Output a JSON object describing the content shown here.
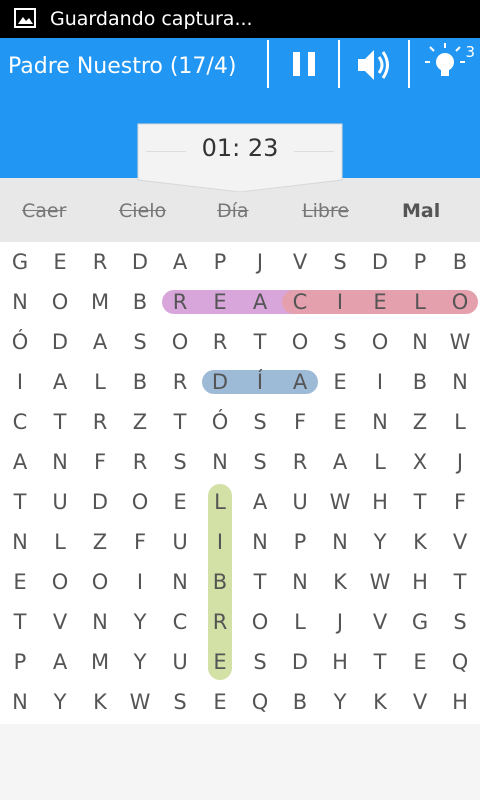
{
  "status_bar": {
    "icon": "image-icon",
    "text": "Guardando captura..."
  },
  "header": {
    "title": "Padre Nuestro (17/4)",
    "pause_icon": "pause-icon",
    "sound_icon": "volume-icon",
    "hint_icon": "lightbulb-icon",
    "hint_count": "3",
    "accent_color": "#2196f3"
  },
  "timer": {
    "value": "01: 23"
  },
  "words": [
    {
      "text": "Caer",
      "found": true
    },
    {
      "text": "Cielo",
      "found": true
    },
    {
      "text": "Día",
      "found": true
    },
    {
      "text": "Libre",
      "found": true
    },
    {
      "text": "Mal",
      "found": false
    }
  ],
  "grid": [
    [
      "G",
      "E",
      "R",
      "D",
      "A",
      "P",
      "J",
      "V",
      "S",
      "D",
      "P",
      "B"
    ],
    [
      "N",
      "O",
      "M",
      "B",
      "R",
      "E",
      "A",
      "C",
      "I",
      "E",
      "L",
      "O"
    ],
    [
      "Ó",
      "D",
      "A",
      "S",
      "O",
      "R",
      "T",
      "O",
      "S",
      "O",
      "N",
      "W"
    ],
    [
      "I",
      "A",
      "L",
      "B",
      "R",
      "D",
      "Í",
      "A",
      "E",
      "I",
      "B",
      "N"
    ],
    [
      "C",
      "T",
      "R",
      "Z",
      "T",
      "Ó",
      "S",
      "F",
      "E",
      "N",
      "Z",
      "L"
    ],
    [
      "A",
      "N",
      "F",
      "R",
      "S",
      "N",
      "S",
      "R",
      "A",
      "L",
      "X",
      "J"
    ],
    [
      "T",
      "U",
      "D",
      "O",
      "E",
      "L",
      "A",
      "U",
      "W",
      "H",
      "T",
      "F"
    ],
    [
      "N",
      "L",
      "Z",
      "F",
      "U",
      "I",
      "N",
      "P",
      "N",
      "Y",
      "K",
      "V"
    ],
    [
      "E",
      "O",
      "O",
      "I",
      "N",
      "B",
      "T",
      "N",
      "K",
      "W",
      "H",
      "T"
    ],
    [
      "T",
      "V",
      "N",
      "Y",
      "C",
      "R",
      "O",
      "L",
      "J",
      "V",
      "G",
      "S"
    ],
    [
      "P",
      "A",
      "M",
      "Y",
      "U",
      "E",
      "S",
      "D",
      "H",
      "T",
      "E",
      "Q"
    ],
    [
      "N",
      "Y",
      "K",
      "W",
      "S",
      "E",
      "Q",
      "B",
      "Y",
      "K",
      "V",
      "H"
    ]
  ],
  "highlights": [
    {
      "word": "Caer",
      "color": "#d9a6dc",
      "from": [
        1,
        4
      ],
      "to": [
        1,
        7
      ]
    },
    {
      "word": "Cielo",
      "color": "#e5a0ad",
      "from": [
        1,
        7
      ],
      "to": [
        1,
        11
      ]
    },
    {
      "word": "Día",
      "color": "#9dbad6",
      "from": [
        3,
        5
      ],
      "to": [
        3,
        7
      ]
    },
    {
      "word": "Libre",
      "color": "#d3e0a6",
      "from": [
        6,
        5
      ],
      "to": [
        10,
        5
      ]
    }
  ]
}
